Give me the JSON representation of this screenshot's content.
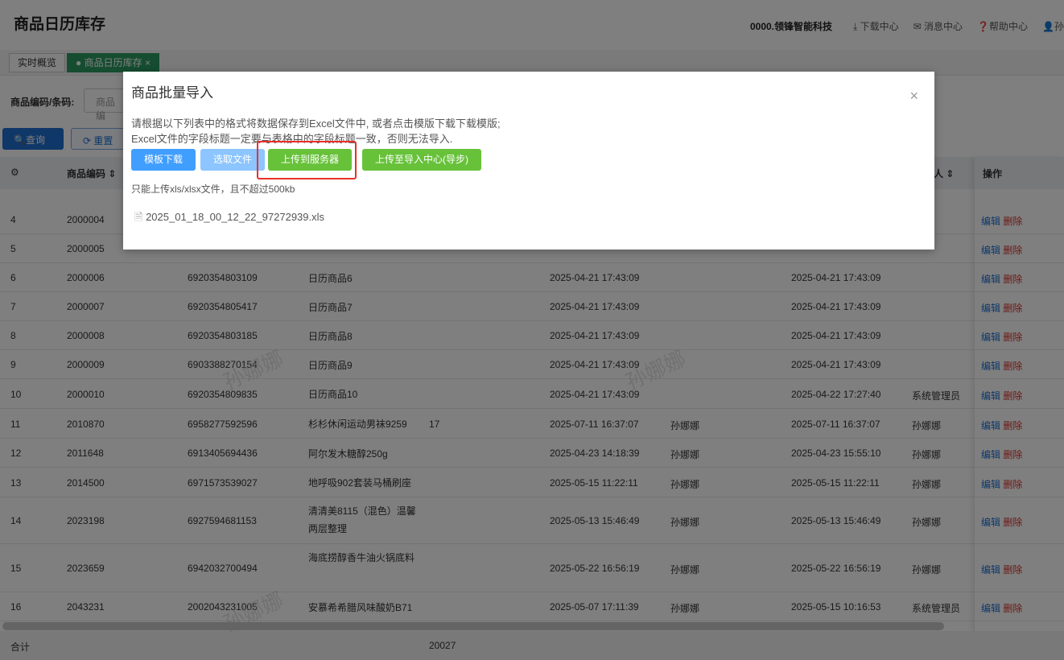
{
  "header": {
    "title": "商品日历库存",
    "org": "0000.领锋智能科技",
    "download": "下载中心",
    "messages": "消息中心",
    "help": "帮助中心",
    "user": "孙"
  },
  "tabs": [
    {
      "label": "实时概览"
    },
    {
      "label": "商品日历库存",
      "close": "×"
    }
  ],
  "filter": {
    "label": "商品编码/条码:",
    "placeholder": "商品编"
  },
  "buttons": {
    "query": "查询",
    "reset": "重置"
  },
  "table": {
    "headers": {
      "code": "商品编码",
      "updater": "人",
      "ops": "操作"
    },
    "rows": [
      {
        "i": "4",
        "code": "2000004",
        "bar": "",
        "name": "",
        "qty": "",
        "ct": "",
        "cu": "",
        "ut": "",
        "uu": ""
      },
      {
        "i": "5",
        "code": "2000005",
        "bar": "",
        "name": "",
        "qty": "",
        "ct": "",
        "cu": "",
        "ut": "",
        "uu": ""
      },
      {
        "i": "6",
        "code": "2000006",
        "bar": "6920354803109",
        "name": "日历商品6",
        "qty": "",
        "ct": "2025-04-21 17:43:09",
        "cu": "",
        "ut": "2025-04-21 17:43:09",
        "uu": ""
      },
      {
        "i": "7",
        "code": "2000007",
        "bar": "6920354805417",
        "name": "日历商品7",
        "qty": "",
        "ct": "2025-04-21 17:43:09",
        "cu": "",
        "ut": "2025-04-21 17:43:09",
        "uu": ""
      },
      {
        "i": "8",
        "code": "2000008",
        "bar": "6920354803185",
        "name": "日历商品8",
        "qty": "",
        "ct": "2025-04-21 17:43:09",
        "cu": "",
        "ut": "2025-04-21 17:43:09",
        "uu": ""
      },
      {
        "i": "9",
        "code": "2000009",
        "bar": "6903388270154",
        "name": "日历商品9",
        "qty": "",
        "ct": "2025-04-21 17:43:09",
        "cu": "",
        "ut": "2025-04-21 17:43:09",
        "uu": ""
      },
      {
        "i": "10",
        "code": "2000010",
        "bar": "6920354809835",
        "name": "日历商品10",
        "qty": "",
        "ct": "2025-04-21 17:43:09",
        "cu": "",
        "ut": "2025-04-22 17:27:40",
        "uu": "系统管理员"
      },
      {
        "i": "11",
        "code": "2010870",
        "bar": "6958277592596",
        "name": "杉杉休闲运动男袜9259",
        "qty": "17",
        "ct": "2025-07-11 16:37:07",
        "cu": "孙娜娜",
        "ut": "2025-07-11 16:37:07",
        "uu": "孙娜娜"
      },
      {
        "i": "12",
        "code": "2011648",
        "bar": "6913405694436",
        "name": "阿尔发木糖醇250g",
        "qty": "",
        "ct": "2025-04-23 14:18:39",
        "cu": "孙娜娜",
        "ut": "2025-04-23 15:55:10",
        "uu": "孙娜娜"
      },
      {
        "i": "13",
        "code": "2014500",
        "bar": "6971573539027",
        "name": "地呼吸902套装马桶刷座",
        "qty": "",
        "ct": "2025-05-15 11:22:11",
        "cu": "孙娜娜",
        "ut": "2025-05-15 11:22:11",
        "uu": "孙娜娜"
      },
      {
        "i": "14",
        "code": "2023198",
        "bar": "6927594681153",
        "name": "清清美8115（混色）温馨两层整理",
        "qty": "",
        "ct": "2025-05-13 15:46:49",
        "cu": "孙娜娜",
        "ut": "2025-05-13 15:46:49",
        "uu": "孙娜娜"
      },
      {
        "i": "15",
        "code": "2023659",
        "bar": "6942032700494",
        "name": "海底捞醇香牛油火锅底料",
        "qty": "",
        "ct": "2025-05-22 16:56:19",
        "cu": "孙娜娜",
        "ut": "2025-05-22 16:56:19",
        "uu": "孙娜娜"
      },
      {
        "i": "16",
        "code": "2043231",
        "bar": "2002043231005",
        "name": "安慕希希腊风味酸奶B71",
        "qty": "",
        "ct": "2025-05-07 17:11:39",
        "cu": "孙娜娜",
        "ut": "2025-05-15 10:16:53",
        "uu": "系统管理员"
      }
    ],
    "edit": "编辑",
    "delete": "删除",
    "footer": {
      "label": "合计",
      "qty_total": "20027"
    }
  },
  "watermark": "孙娜娜",
  "modal": {
    "title": "商品批量导入",
    "close": "×",
    "desc1": "请根据以下列表中的格式将数据保存到Excel文件中, 或者点击模版下载下载模版;",
    "desc2": "Excel文件的字段标题一定要与表格中的字段标题一致，否则无法导入.",
    "btn_template": "模板下载",
    "btn_select": "选取文件",
    "btn_upload": "上传到服务器",
    "btn_import_center": "上传至导入中心(导步)",
    "hint": "只能上传xls/xlsx文件，且不超过500kb",
    "file": "2025_01_18_00_12_22_97272939.xls"
  }
}
